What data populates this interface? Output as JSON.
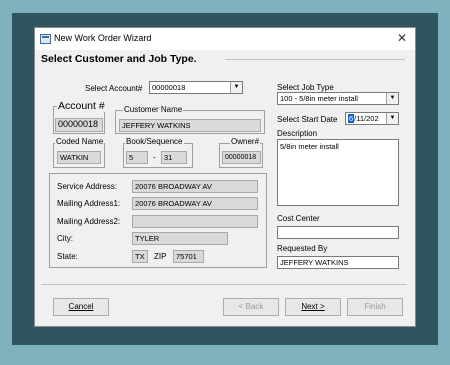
{
  "window": {
    "title": "New Work Order Wizard",
    "close_glyph": "✕"
  },
  "heading": "Select Customer and Job Type.",
  "account_select": {
    "label": "Select Account#",
    "value": "00000018"
  },
  "account_number": {
    "label": "Account #",
    "value": "00000018"
  },
  "customer_name": {
    "label": "Customer Name",
    "value": "JEFFERY WATKINS"
  },
  "coded_name": {
    "label": "Coded Name",
    "value": "WATKIN"
  },
  "book_sequence": {
    "label": "Book/Sequence",
    "book": "5",
    "separator": "-",
    "sequence": "31"
  },
  "owner": {
    "label": "Owner#",
    "value": "00000018"
  },
  "address": {
    "service_label": "Service Address:",
    "service_value": "20076 BROADWAY AV",
    "mailing1_label": "Mailing Address1:",
    "mailing1_value": "20076 BROADWAY AV",
    "mailing2_label": "Mailing Address2:",
    "mailing2_value": "",
    "city_label": "City:",
    "city_value": "TYLER",
    "state_label": "State:",
    "state_value": "TX",
    "zip_label": "ZIP",
    "zip_value": "75701"
  },
  "job_type": {
    "label": "Select Job Type",
    "value": "100 - 5/8in meter install"
  },
  "start_date": {
    "label": "Select Start Date",
    "month": "6",
    "rest": "/11/202"
  },
  "description": {
    "label": "Description",
    "value": "5/8in meter install"
  },
  "cost_center": {
    "label": "Cost Center",
    "value": ""
  },
  "requested_by": {
    "label": "Requested By",
    "value": "JEFFERY WATKINS"
  },
  "buttons": {
    "cancel": "Cancel",
    "back": "< Back",
    "next": "Next >",
    "finish": "Finish"
  }
}
